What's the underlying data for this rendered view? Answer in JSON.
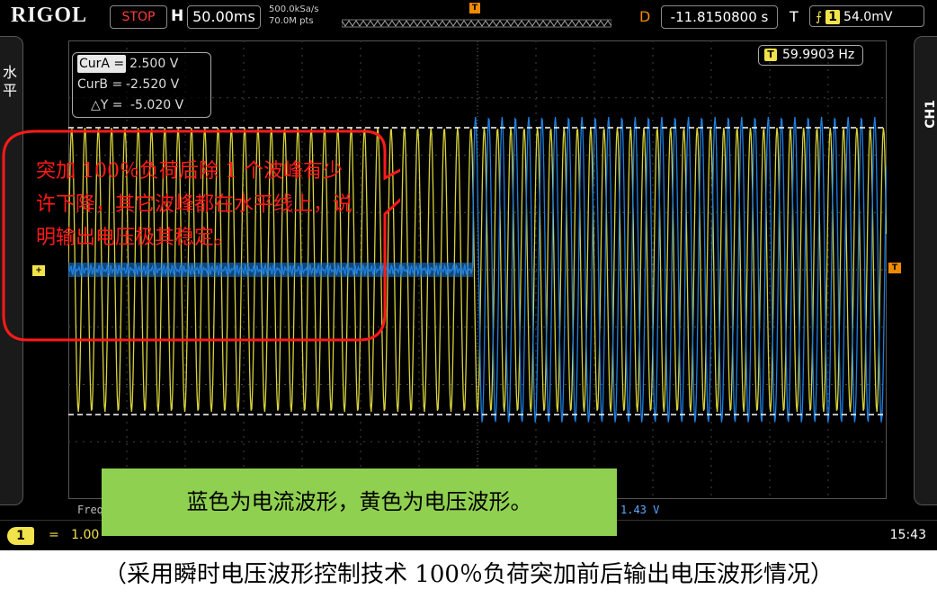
{
  "topbar": {
    "brand": "RIGOL",
    "run_state": "STOP",
    "h_label": "H",
    "timebase": "50.00ms",
    "sample_rate": "500.0kSa/s",
    "memory_depth": "70.0M pts",
    "trigger_marker": "T",
    "d_label": "D",
    "delay": "-11.8150800 s",
    "t_label": "T",
    "trigger_icon": "edge-rising-icon",
    "trigger_channel": "1",
    "trigger_level": "54.0mV"
  },
  "left_tab": {
    "label": "水平"
  },
  "right_tab": {
    "label": "CH1"
  },
  "cursor": {
    "a_label": "CurA =",
    "a_value": "2.500 V",
    "b_label": "CurB =",
    "b_value": "-2.520 V",
    "dy_label": "△Y =",
    "dy_value": "-5.020 V"
  },
  "frequency": {
    "channel": "T",
    "value": "59.9903 Hz"
  },
  "annotation": {
    "text": "突加 100％负荷后除 1 个波峰有少许下降，其它波峰都在水平线上，说明输出电压极其稳定。"
  },
  "note": {
    "text": "蓝色为电流波形，黄色为电压波形。"
  },
  "hidden_labels": {
    "freq_prefix": "Freq",
    "amplitude": "1.43 V"
  },
  "bottombar": {
    "channel": "1",
    "coupling": "=",
    "scale": "1.00",
    "time": "15:43"
  },
  "caption": "（采用瞬时电压波形控制技术 100％负荷突加前后输出电压波形情况）",
  "colors": {
    "voltage": "#d9d23a",
    "current": "#1e7fe0",
    "accent": "#f08a00",
    "annotation": "#ff1a1a",
    "note_bg": "#90d050"
  }
}
